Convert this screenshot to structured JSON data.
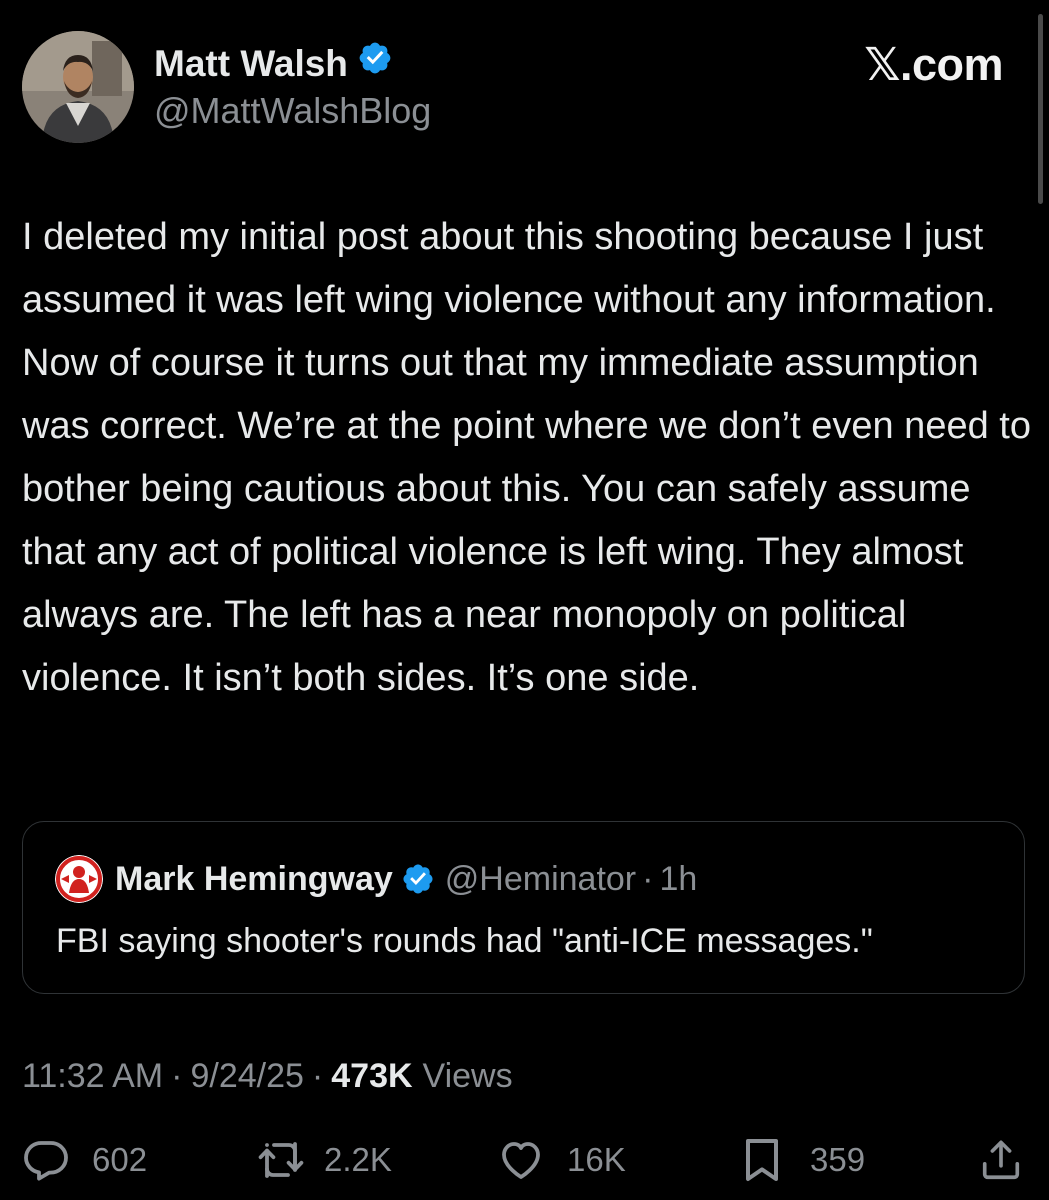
{
  "post": {
    "author_name": "Matt Walsh",
    "handle": "@MattWalshBlog",
    "verified": true,
    "brand": "𝕏.com",
    "text": "I deleted my initial post about this shooting because I just assumed it was left wing violence without any information. Now of course it turns out that my immediate assumption was correct. We’re at the point where we don’t even need to bother being cautious about this. You can safely assume that any act of political violence is left wing. They almost always are. The left has a near monopoly on political violence. It isn’t both sides. It’s one side."
  },
  "quoted_post": {
    "author_name": "Mark Hemingway",
    "handle": "@Heminator",
    "separator": "·",
    "time": "1h",
    "verified": true,
    "text": "FBI saying shooter's rounds had \"anti-ICE messages.\""
  },
  "meta": {
    "time": "11:32 AM",
    "separator": "·",
    "date": "9/24/25",
    "views_count": "473K",
    "views_label": "Views"
  },
  "actions": {
    "replies": "602",
    "reposts": "2.2K",
    "likes": "16K",
    "bookmarks": "359"
  },
  "colors": {
    "background": "#000000",
    "text_primary": "#e7e9ea",
    "text_secondary": "#8b8f94",
    "verified_blue": "#1d9bf0",
    "border": "#2f3336"
  },
  "icons": {
    "verified": "verified-badge-icon",
    "reply": "reply-bubble-icon",
    "repost": "repost-arrows-icon",
    "like": "heart-icon",
    "bookmark": "bookmark-icon",
    "share": "share-upload-icon"
  }
}
